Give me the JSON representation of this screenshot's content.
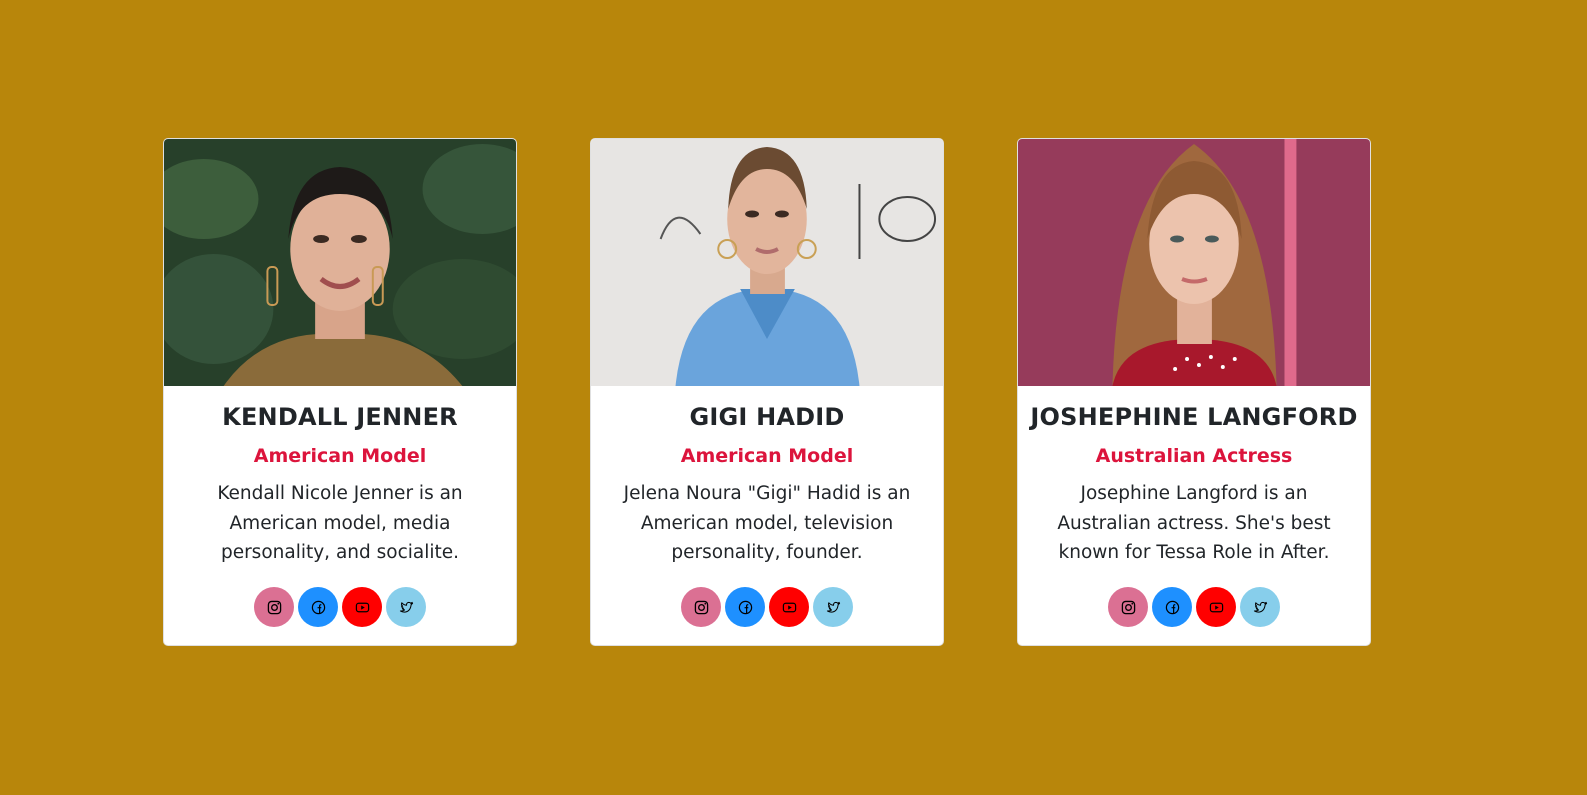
{
  "colors": {
    "page_background": "#b8860b",
    "card_background": "#ffffff",
    "name_text": "#212529",
    "role_text": "#dc143c",
    "instagram": "#db7093",
    "facebook": "#1e90ff",
    "youtube": "#ff0000",
    "twitter": "#87ceeb"
  },
  "cards": [
    {
      "name": "KENDALL JENNER",
      "role": "American Model",
      "bio": "Kendall Nicole Jenner is an American model, media personality, and socialite.",
      "photo_alt": "Kendall Jenner portrait",
      "socials": [
        "instagram-icon",
        "facebook-icon",
        "youtube-icon",
        "twitter-icon"
      ]
    },
    {
      "name": "GIGI HADID",
      "role": "American Model",
      "bio": "Jelena Noura \"Gigi\" Hadid is an American model, television personality, founder.",
      "photo_alt": "Gigi Hadid portrait",
      "socials": [
        "instagram-icon",
        "facebook-icon",
        "youtube-icon",
        "twitter-icon"
      ]
    },
    {
      "name": "JOSHEPHINE LANGFORD",
      "role": "Australian Actress",
      "bio": "Josephine Langford is an Australian actress. She's best known for Tessa Role in After.",
      "photo_alt": "Josephine Langford portrait",
      "socials": [
        "instagram-icon",
        "facebook-icon",
        "youtube-icon",
        "twitter-icon"
      ]
    }
  ]
}
